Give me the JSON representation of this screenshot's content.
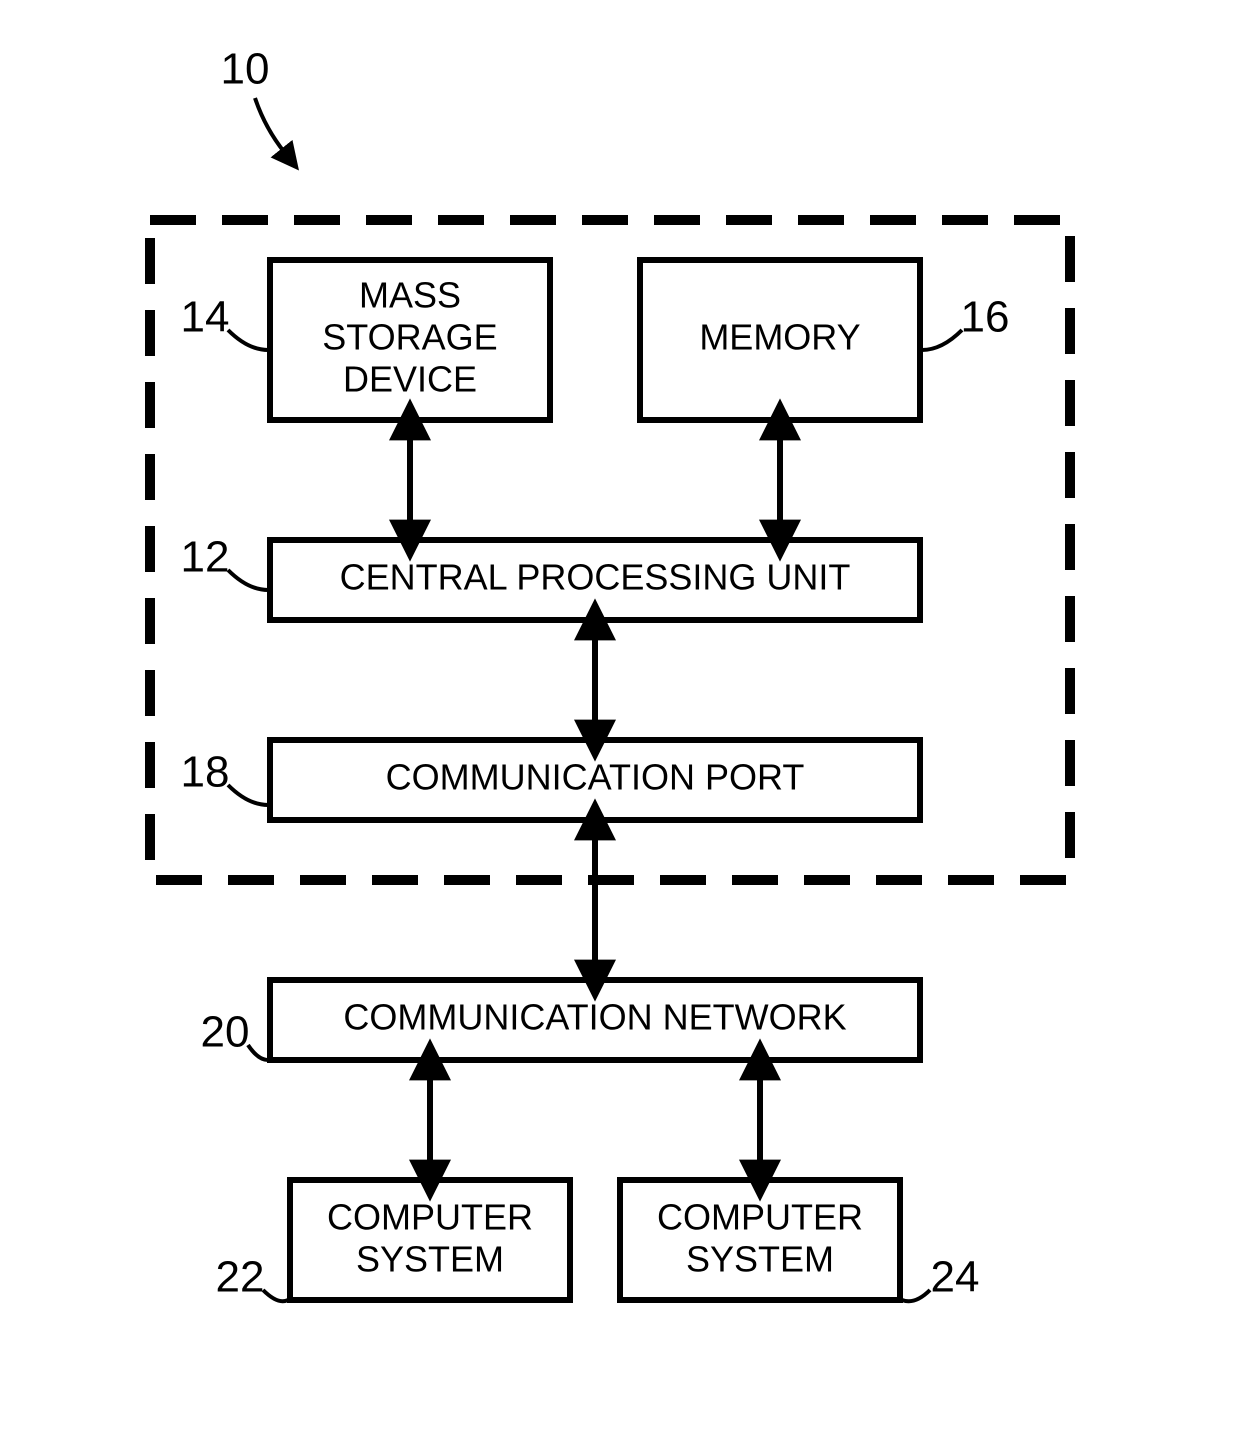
{
  "figure_ref": "10",
  "dashed_box": {
    "ref": null
  },
  "blocks": {
    "mass_storage": {
      "ref": "14",
      "line1": "MASS",
      "line2": "STORAGE",
      "line3": "DEVICE"
    },
    "memory": {
      "ref": "16",
      "line1": "MEMORY"
    },
    "cpu": {
      "ref": "12",
      "line1": "CENTRAL PROCESSING UNIT"
    },
    "comm_port": {
      "ref": "18",
      "line1": "COMMUNICATION PORT"
    },
    "comm_net": {
      "ref": "20",
      "line1": "COMMUNICATION NETWORK"
    },
    "comp_sys_l": {
      "ref": "22",
      "line1": "COMPUTER",
      "line2": "SYSTEM"
    },
    "comp_sys_r": {
      "ref": "24",
      "line1": "COMPUTER",
      "line2": "SYSTEM"
    }
  }
}
